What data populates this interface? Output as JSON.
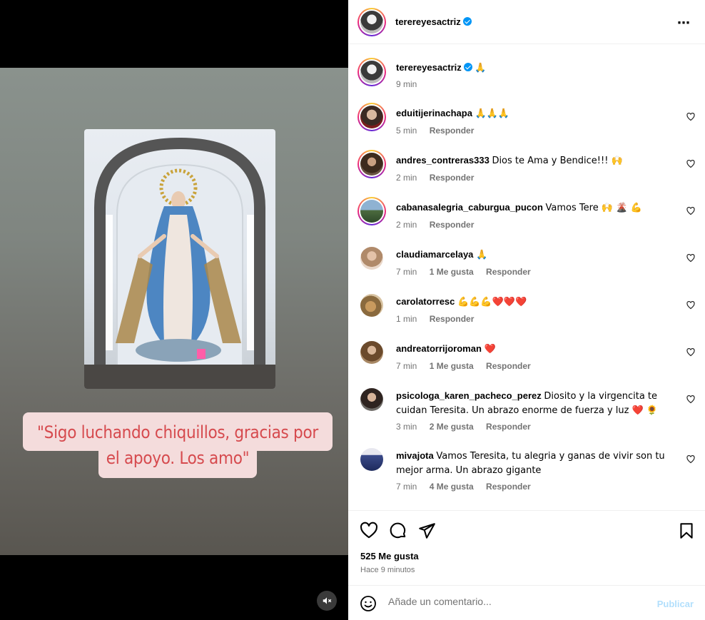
{
  "post": {
    "author": "terereyesactriz",
    "caption_lines": [
      "\"Sigo luchando chiquillos, gracias por",
      "el apoyo. Los amo\""
    ],
    "likes": "525 Me gusta",
    "time_ago": "Hace 9 minutos",
    "more_icon": "⋯"
  },
  "author_comment": {
    "username": "terereyesactriz",
    "text": "🙏",
    "time": "9 min"
  },
  "reply_label": "Responder",
  "comments": [
    {
      "username": "eduitijerinachapa",
      "text": "🙏🙏🙏",
      "time": "5 min",
      "likes": ""
    },
    {
      "username": "andres_contreras333",
      "text": "Dios te Ama y Bendice!!! 🙌",
      "time": "2 min",
      "likes": ""
    },
    {
      "username": "cabanasalegria_caburgua_pucon",
      "text": "Vamos Tere 🙌 🌋 💪",
      "time": "2 min",
      "likes": ""
    },
    {
      "username": "claudiamarcelaya",
      "text": "🙏",
      "time": "7 min",
      "likes": "1 Me gusta"
    },
    {
      "username": "carolatorresc",
      "text": "💪💪💪❤️❤️❤️",
      "time": "1 min",
      "likes": ""
    },
    {
      "username": "andreatorrijoroman",
      "text": "❤️",
      "time": "7 min",
      "likes": "1 Me gusta"
    },
    {
      "username": "psicologa_karen_pacheco_perez",
      "text": "Diosito y la virgencita te cuidan Teresita. Un abrazo enorme de fuerza y luz ❤️ 🌻",
      "time": "3 min",
      "likes": "2 Me gusta"
    },
    {
      "username": "mivajota",
      "text": "Vamos Teresita, tu alegria y ganas de vivir son tu mejor arma. Un abrazo gigante",
      "time": "7 min",
      "likes": "4 Me gusta"
    }
  ],
  "add_comment": {
    "placeholder": "Añade un comentario...",
    "publish_label": "Publicar"
  },
  "colors": {
    "accent": "#0095f6",
    "caption_text": "#d64a4e",
    "caption_bg": "#f4dcdc",
    "muted": "#737373"
  }
}
